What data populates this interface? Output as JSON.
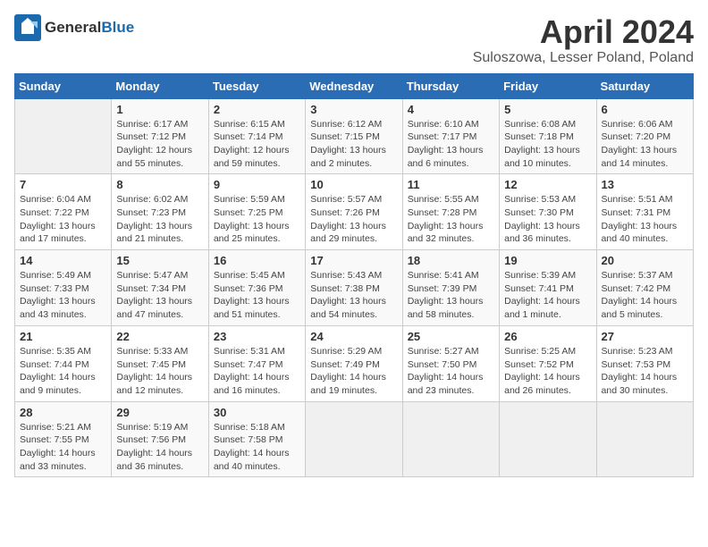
{
  "header": {
    "logo_general": "General",
    "logo_blue": "Blue",
    "title": "April 2024",
    "subtitle": "Suloszowa, Lesser Poland, Poland"
  },
  "days_of_week": [
    "Sunday",
    "Monday",
    "Tuesday",
    "Wednesday",
    "Thursday",
    "Friday",
    "Saturday"
  ],
  "weeks": [
    [
      {
        "day": "",
        "info": ""
      },
      {
        "day": "1",
        "info": "Sunrise: 6:17 AM\nSunset: 7:12 PM\nDaylight: 12 hours\nand 55 minutes."
      },
      {
        "day": "2",
        "info": "Sunrise: 6:15 AM\nSunset: 7:14 PM\nDaylight: 12 hours\nand 59 minutes."
      },
      {
        "day": "3",
        "info": "Sunrise: 6:12 AM\nSunset: 7:15 PM\nDaylight: 13 hours\nand 2 minutes."
      },
      {
        "day": "4",
        "info": "Sunrise: 6:10 AM\nSunset: 7:17 PM\nDaylight: 13 hours\nand 6 minutes."
      },
      {
        "day": "5",
        "info": "Sunrise: 6:08 AM\nSunset: 7:18 PM\nDaylight: 13 hours\nand 10 minutes."
      },
      {
        "day": "6",
        "info": "Sunrise: 6:06 AM\nSunset: 7:20 PM\nDaylight: 13 hours\nand 14 minutes."
      }
    ],
    [
      {
        "day": "7",
        "info": "Sunrise: 6:04 AM\nSunset: 7:22 PM\nDaylight: 13 hours\nand 17 minutes."
      },
      {
        "day": "8",
        "info": "Sunrise: 6:02 AM\nSunset: 7:23 PM\nDaylight: 13 hours\nand 21 minutes."
      },
      {
        "day": "9",
        "info": "Sunrise: 5:59 AM\nSunset: 7:25 PM\nDaylight: 13 hours\nand 25 minutes."
      },
      {
        "day": "10",
        "info": "Sunrise: 5:57 AM\nSunset: 7:26 PM\nDaylight: 13 hours\nand 29 minutes."
      },
      {
        "day": "11",
        "info": "Sunrise: 5:55 AM\nSunset: 7:28 PM\nDaylight: 13 hours\nand 32 minutes."
      },
      {
        "day": "12",
        "info": "Sunrise: 5:53 AM\nSunset: 7:30 PM\nDaylight: 13 hours\nand 36 minutes."
      },
      {
        "day": "13",
        "info": "Sunrise: 5:51 AM\nSunset: 7:31 PM\nDaylight: 13 hours\nand 40 minutes."
      }
    ],
    [
      {
        "day": "14",
        "info": "Sunrise: 5:49 AM\nSunset: 7:33 PM\nDaylight: 13 hours\nand 43 minutes."
      },
      {
        "day": "15",
        "info": "Sunrise: 5:47 AM\nSunset: 7:34 PM\nDaylight: 13 hours\nand 47 minutes."
      },
      {
        "day": "16",
        "info": "Sunrise: 5:45 AM\nSunset: 7:36 PM\nDaylight: 13 hours\nand 51 minutes."
      },
      {
        "day": "17",
        "info": "Sunrise: 5:43 AM\nSunset: 7:38 PM\nDaylight: 13 hours\nand 54 minutes."
      },
      {
        "day": "18",
        "info": "Sunrise: 5:41 AM\nSunset: 7:39 PM\nDaylight: 13 hours\nand 58 minutes."
      },
      {
        "day": "19",
        "info": "Sunrise: 5:39 AM\nSunset: 7:41 PM\nDaylight: 14 hours\nand 1 minute."
      },
      {
        "day": "20",
        "info": "Sunrise: 5:37 AM\nSunset: 7:42 PM\nDaylight: 14 hours\nand 5 minutes."
      }
    ],
    [
      {
        "day": "21",
        "info": "Sunrise: 5:35 AM\nSunset: 7:44 PM\nDaylight: 14 hours\nand 9 minutes."
      },
      {
        "day": "22",
        "info": "Sunrise: 5:33 AM\nSunset: 7:45 PM\nDaylight: 14 hours\nand 12 minutes."
      },
      {
        "day": "23",
        "info": "Sunrise: 5:31 AM\nSunset: 7:47 PM\nDaylight: 14 hours\nand 16 minutes."
      },
      {
        "day": "24",
        "info": "Sunrise: 5:29 AM\nSunset: 7:49 PM\nDaylight: 14 hours\nand 19 minutes."
      },
      {
        "day": "25",
        "info": "Sunrise: 5:27 AM\nSunset: 7:50 PM\nDaylight: 14 hours\nand 23 minutes."
      },
      {
        "day": "26",
        "info": "Sunrise: 5:25 AM\nSunset: 7:52 PM\nDaylight: 14 hours\nand 26 minutes."
      },
      {
        "day": "27",
        "info": "Sunrise: 5:23 AM\nSunset: 7:53 PM\nDaylight: 14 hours\nand 30 minutes."
      }
    ],
    [
      {
        "day": "28",
        "info": "Sunrise: 5:21 AM\nSunset: 7:55 PM\nDaylight: 14 hours\nand 33 minutes."
      },
      {
        "day": "29",
        "info": "Sunrise: 5:19 AM\nSunset: 7:56 PM\nDaylight: 14 hours\nand 36 minutes."
      },
      {
        "day": "30",
        "info": "Sunrise: 5:18 AM\nSunset: 7:58 PM\nDaylight: 14 hours\nand 40 minutes."
      },
      {
        "day": "",
        "info": ""
      },
      {
        "day": "",
        "info": ""
      },
      {
        "day": "",
        "info": ""
      },
      {
        "day": "",
        "info": ""
      }
    ]
  ]
}
